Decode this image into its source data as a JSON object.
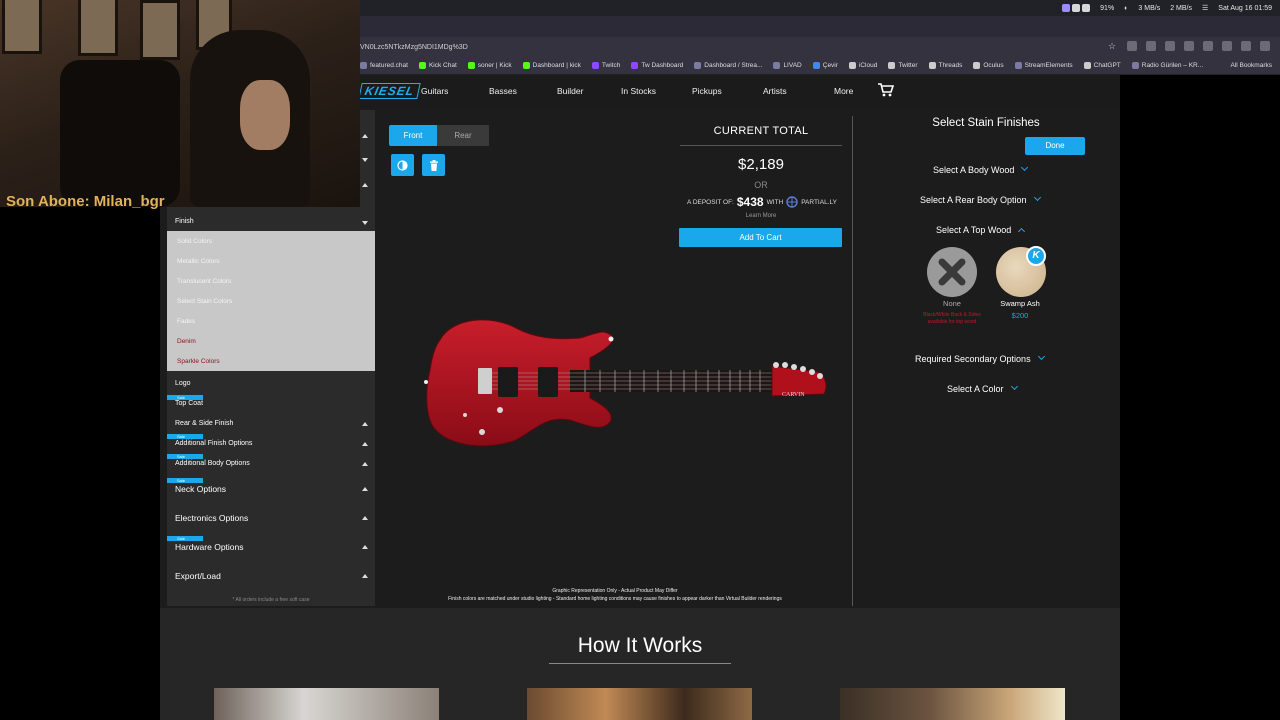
{
  "menubar": {
    "battery": "91%",
    "net_up": "3 MB/s",
    "net_down": "2 MB/s",
    "datetime": "Sat Aug 16  01:59"
  },
  "browser": {
    "url": "VN0Lzc5NTkzMzg5NDI1MDg%3D",
    "bookmarks": [
      "featured.chat",
      "Kick Chat",
      "soner | Kick",
      "Dashboard | kick",
      "Twitch",
      "Tw Dashboard",
      "Dashboard / Strea...",
      "LIVAD",
      "Çevir",
      "iCloud",
      "Twitter",
      "Threads",
      "Oculus",
      "StreamElements",
      "ChatGPT",
      "Radio Gürilen – KR..."
    ],
    "all_bookmarks": "All Bookmarks"
  },
  "site": {
    "logo": "KIESEL",
    "nav": [
      "Guitars",
      "Basses",
      "Builder",
      "In Stocks",
      "Pickups",
      "Artists",
      "More"
    ]
  },
  "sidebar": {
    "finish_header": "Finish",
    "finish_items": [
      {
        "label": "Solid Colors",
        "style": "light"
      },
      {
        "label": "Metallic Colors",
        "style": "light"
      },
      {
        "label": "Translucent Colors",
        "style": "light"
      },
      {
        "label": "Select Stain Colors",
        "style": "light"
      },
      {
        "label": "Fades",
        "style": "light"
      },
      {
        "label": "Denim",
        "style": "red"
      },
      {
        "label": "Sparkle Colors",
        "style": "red"
      }
    ],
    "logo": "Logo",
    "top_coat": "Top Coat",
    "rear_side_finish": "Rear & Side Finish",
    "additional_finish": "Additional Finish Options",
    "additional_body": "Additional Body Options",
    "neck": "Neck Options",
    "electronics": "Electronics Options",
    "hardware": "Hardware Options",
    "export": "Export/Load",
    "footer": "* All orders include a free soft case",
    "sale": "Sale"
  },
  "viewer": {
    "front": "Front",
    "rear": "Rear",
    "headstock_logo": "CARVIN",
    "disclaimer_1": "Graphic Representation Only - Actual Product May Differ",
    "disclaimer_2": "Finish colors are matched under studio lighting - Standard home lighting conditions may cause finishes to appear darker than Virtual Builder renderings"
  },
  "total": {
    "title": "CURRENT TOTAL",
    "price": "$2,189",
    "or": "OR",
    "deposit_prefix": "A DEPOSIT OF:",
    "deposit_amount": "$438",
    "deposit_with": "WITH",
    "provider": "PARTIAL.LY",
    "learn_more": "Learn More",
    "cart_button": "Add To Cart"
  },
  "stain": {
    "title": "Select Stain Finishes",
    "done": "Done",
    "body_wood": "Select A Body Wood",
    "rear_body": "Select A Rear Body Option",
    "top_wood": "Select A Top Wood",
    "none_label": "None",
    "none_warning": "Black/White Back & Sides available for top wood",
    "ash_label": "Swamp Ash",
    "ash_price": "$200",
    "ash_badge": "K",
    "secondary": "Required Secondary Options",
    "color": "Select A Color"
  },
  "how_it_works": {
    "title": "How It Works"
  },
  "stream": {
    "overlay_text": "Son Abone: Milan_bgr"
  },
  "colors": {
    "accent": "#1aa7ec",
    "guitar_red": "#b0101c",
    "overlay_gold": "#e0b25c"
  }
}
